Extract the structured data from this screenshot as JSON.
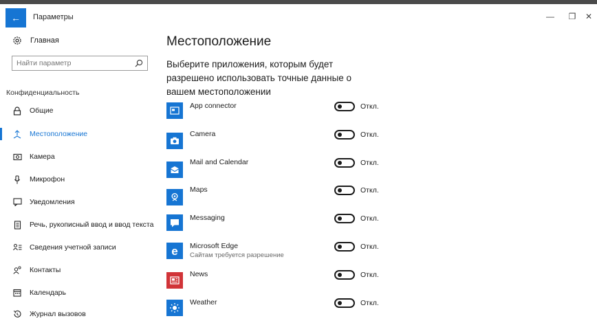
{
  "window": {
    "title": "Параметры"
  },
  "sidebar": {
    "home": "Главная",
    "search_placeholder": "Найти параметр",
    "section": "Конфиденциальность",
    "items": [
      {
        "label": "Общие",
        "icon": "lock-icon"
      },
      {
        "label": "Местоположение",
        "icon": "location-icon",
        "active": true
      },
      {
        "label": "Камера",
        "icon": "camera-icon"
      },
      {
        "label": "Микрофон",
        "icon": "microphone-icon"
      },
      {
        "label": "Уведомления",
        "icon": "notification-icon"
      },
      {
        "label": "Речь, рукописный ввод и ввод текста",
        "icon": "speech-icon"
      },
      {
        "label": "Сведения учетной записи",
        "icon": "account-info-icon"
      },
      {
        "label": "Контакты",
        "icon": "contacts-icon"
      },
      {
        "label": "Календарь",
        "icon": "calendar-icon"
      },
      {
        "label": "Журнал вызовов",
        "icon": "call-history-icon"
      }
    ]
  },
  "main": {
    "title": "Местоположение",
    "description": "Выберите приложения, которым будет разрешено использовать точные данные о вашем местоположении",
    "apps": [
      {
        "name": "App connector",
        "sub": "",
        "toggle": "Откл.",
        "icon": "app-connector-icon",
        "color": "#1675d3"
      },
      {
        "name": "Camera",
        "sub": "",
        "toggle": "Откл.",
        "icon": "camera-app-icon",
        "color": "#1675d3"
      },
      {
        "name": "Mail and Calendar",
        "sub": "",
        "toggle": "Откл.",
        "icon": "mail-icon",
        "color": "#1675d3"
      },
      {
        "name": "Maps",
        "sub": "",
        "toggle": "Откл.",
        "icon": "maps-icon",
        "color": "#1675d3"
      },
      {
        "name": "Messaging",
        "sub": "",
        "toggle": "Откл.",
        "icon": "messaging-icon",
        "color": "#1675d3"
      },
      {
        "name": "Microsoft Edge",
        "sub": "Сайтам требуется разрешение",
        "toggle": "Откл.",
        "icon": "edge-icon",
        "color": "#1675d3"
      },
      {
        "name": "News",
        "sub": "",
        "toggle": "Откл.",
        "icon": "news-icon",
        "color": "#d13438"
      },
      {
        "name": "Weather",
        "sub": "",
        "toggle": "Откл.",
        "icon": "weather-icon",
        "color": "#1675d3"
      }
    ]
  },
  "colors": {
    "accent": "#1675d3",
    "news": "#d13438"
  }
}
